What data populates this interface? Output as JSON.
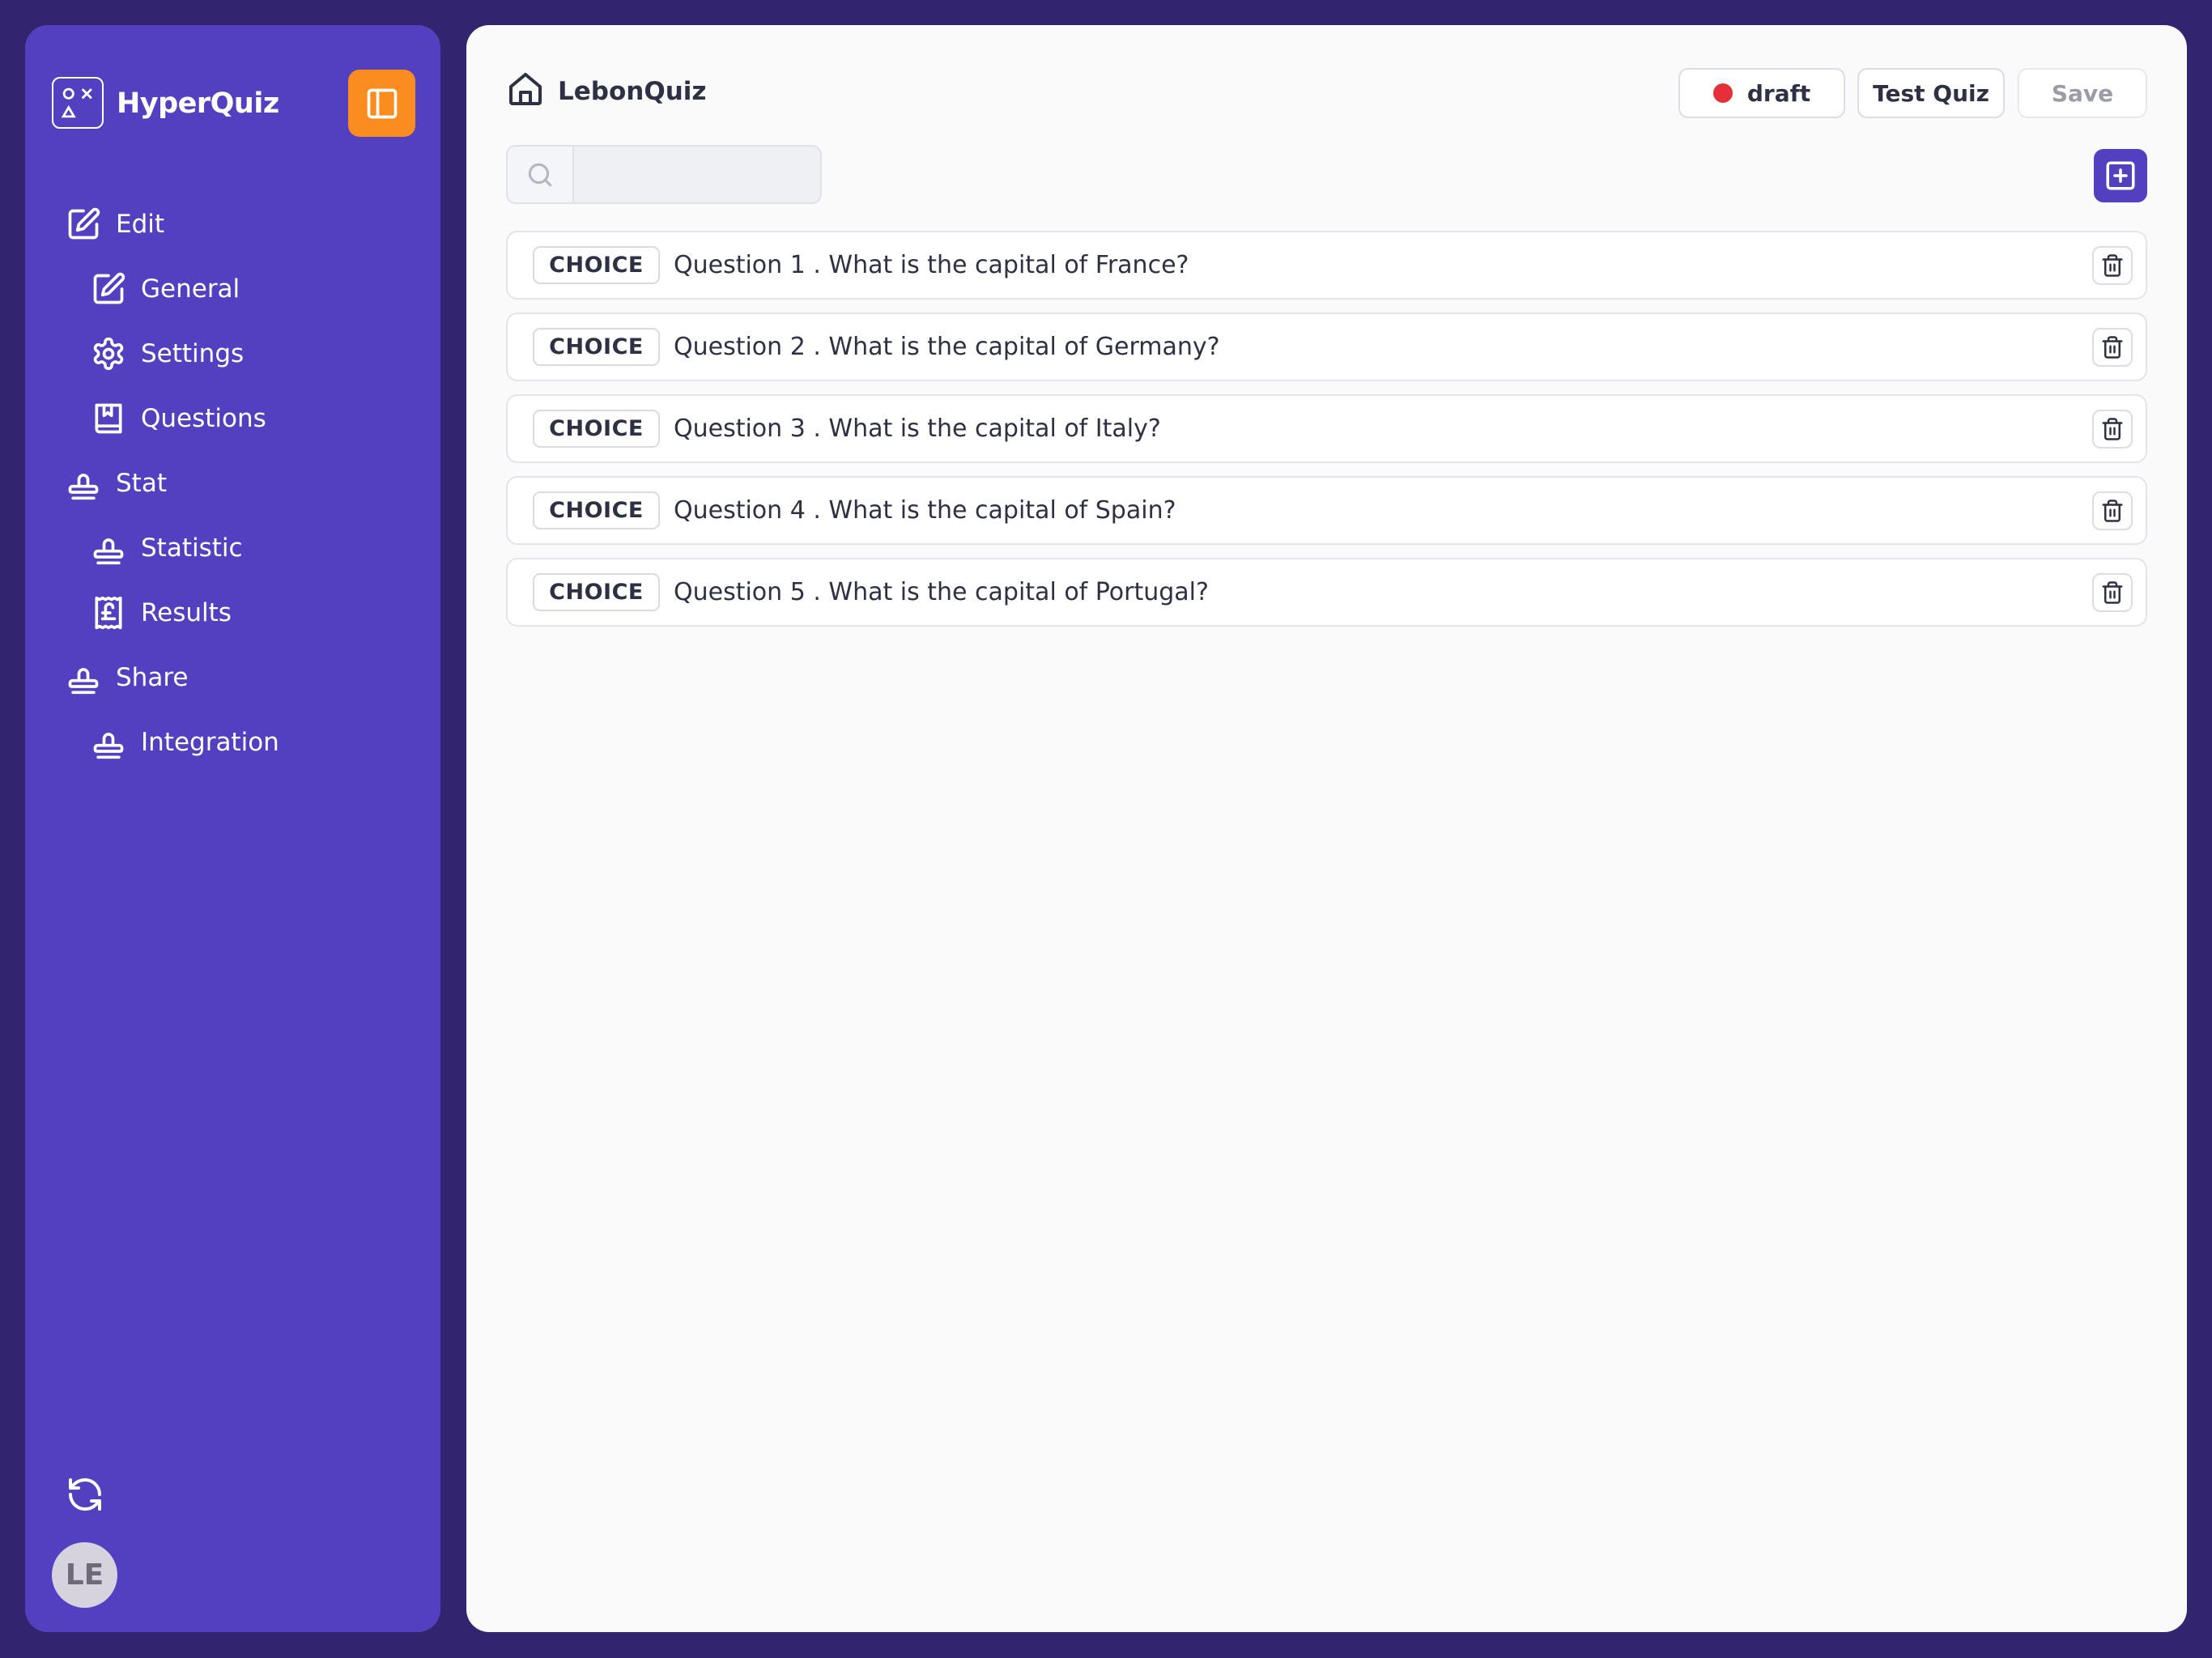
{
  "app": {
    "name": "HyperQuiz"
  },
  "sidebar": {
    "items": [
      {
        "label": "Edit",
        "icon": "edit-icon",
        "level": 0
      },
      {
        "label": "General",
        "icon": "edit-icon",
        "level": 1
      },
      {
        "label": "Settings",
        "icon": "gear-icon",
        "level": 1
      },
      {
        "label": "Questions",
        "icon": "book-icon",
        "level": 1
      },
      {
        "label": "Stat",
        "icon": "stamp-icon",
        "level": 0
      },
      {
        "label": "Statistic",
        "icon": "stamp-icon",
        "level": 1
      },
      {
        "label": "Results",
        "icon": "receipt-icon",
        "level": 1
      },
      {
        "label": "Share",
        "icon": "stamp-icon",
        "level": 0
      },
      {
        "label": "Integration",
        "icon": "stamp-icon",
        "level": 1
      }
    ],
    "avatar_initials": "LE"
  },
  "header": {
    "breadcrumb": "LebonQuiz",
    "status_label": "draft",
    "status_color": "#e5303a",
    "test_label": "Test Quiz",
    "save_label": "Save"
  },
  "search": {
    "value": "",
    "placeholder": ""
  },
  "questions": [
    {
      "type": "CHOICE",
      "text": "Question 1 . What is the capital of France?"
    },
    {
      "type": "CHOICE",
      "text": "Question 2 . What is the capital of Germany?"
    },
    {
      "type": "CHOICE",
      "text": "Question 3 . What is the capital of Italy?"
    },
    {
      "type": "CHOICE",
      "text": "Question 4 . What is the capital of Spain?"
    },
    {
      "type": "CHOICE",
      "text": "Question 5 . What is the capital of Portugal?"
    }
  ],
  "colors": {
    "background": "#33246f",
    "sidebar": "#5340c1",
    "accent_orange": "#fb8c20",
    "primary": "#5340c1"
  }
}
